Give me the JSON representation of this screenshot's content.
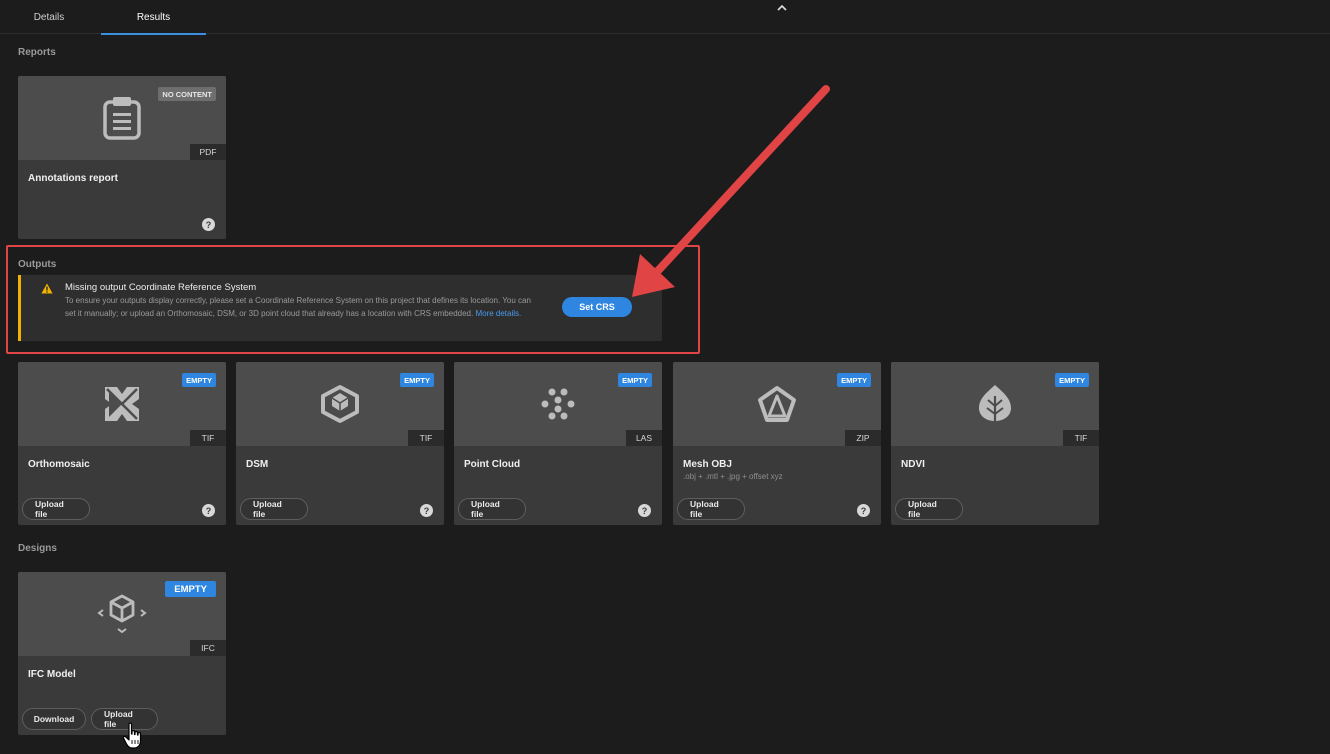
{
  "tabs": [
    {
      "label": "Details"
    },
    {
      "label": "Results",
      "active": true
    }
  ],
  "sections": {
    "reports": "Reports",
    "outputs": "Outputs",
    "designs": "Designs"
  },
  "reports": [
    {
      "title": "Annotations report",
      "badge": "NO CONTENT",
      "ext": "PDF",
      "icon": "clipboard-icon"
    }
  ],
  "crs_banner": {
    "title": "Missing output Coordinate Reference System",
    "body": "To ensure your outputs display correctly, please set a Coordinate Reference System on this project that defines its location. You can set it manually; or upload an Orthomosaic, DSM, or 3D point cloud that already has a location with CRS embedded.",
    "link": "More details.",
    "button": "Set CRS"
  },
  "outputs": [
    {
      "title": "Orthomosaic",
      "badge": "EMPTY",
      "ext": "TIF",
      "button": "Upload file",
      "icon": "orthomosaic-icon"
    },
    {
      "title": "DSM",
      "badge": "EMPTY",
      "ext": "TIF",
      "button": "Upload file",
      "icon": "dsm-icon"
    },
    {
      "title": "Point Cloud",
      "badge": "EMPTY",
      "ext": "LAS",
      "button": "Upload file",
      "icon": "point-cloud-icon"
    },
    {
      "title": "Mesh OBJ",
      "subtitle": ".obj + .mtl + .jpg + offset xyz",
      "badge": "EMPTY",
      "ext": "ZIP",
      "button": "Upload file",
      "icon": "mesh-icon"
    },
    {
      "title": "NDVI",
      "badge": "EMPTY",
      "ext": "TIF",
      "button": "Upload file",
      "icon": "leaf-icon"
    }
  ],
  "designs": [
    {
      "title": "IFC Model",
      "badge": "EMPTY",
      "ext": "IFC",
      "download": "Download",
      "button": "Upload file",
      "icon": "ifc-cube-icon"
    }
  ],
  "colors": {
    "accent": "#2f86e0",
    "warning": "#f2b300",
    "annotation": "#e04444"
  }
}
